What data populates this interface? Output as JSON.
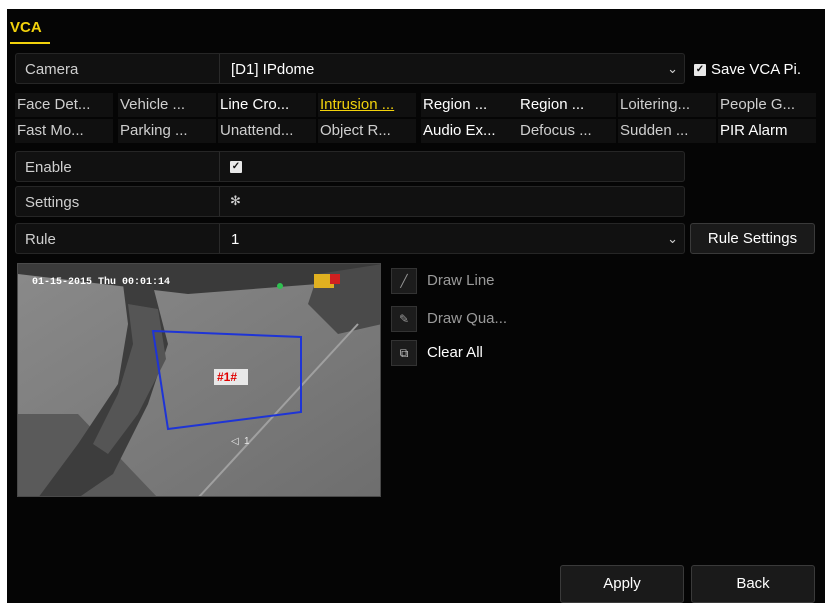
{
  "window": {
    "title": "VCA"
  },
  "camera": {
    "label": "Camera",
    "value": "[D1] IPdome",
    "save_label": "Save VCA Pi."
  },
  "tabs_row1": [
    "Face Det...",
    "Vehicle ...",
    "Line Cro...",
    "Intrusion ...",
    "Region ...",
    "Region ...",
    "Loitering...",
    "People G..."
  ],
  "tabs_row2": [
    "Fast Mo...",
    "Parking ...",
    "Unattend...",
    "Object R...",
    "Audio Ex...",
    "Defocus ...",
    "Sudden ...",
    "PIR Alarm"
  ],
  "enable": {
    "label": "Enable",
    "checked": true
  },
  "settings": {
    "label": "Settings"
  },
  "rule": {
    "label": "Rule",
    "value": "1",
    "button": "Rule Settings"
  },
  "preview": {
    "timestamp": "01-15-2015 Thu 00:01:14",
    "region_label": "#1#",
    "marker_label": "1"
  },
  "tools": {
    "draw_line": "Draw Line",
    "draw_quad": "Draw Qua...",
    "clear_all": "Clear All"
  },
  "footer": {
    "apply": "Apply",
    "back": "Back"
  },
  "colors": {
    "accent": "#f2d20c",
    "region": "#1e34d6",
    "region_label_bg": "#e8e8e8",
    "region_label_text": "#e00000"
  }
}
